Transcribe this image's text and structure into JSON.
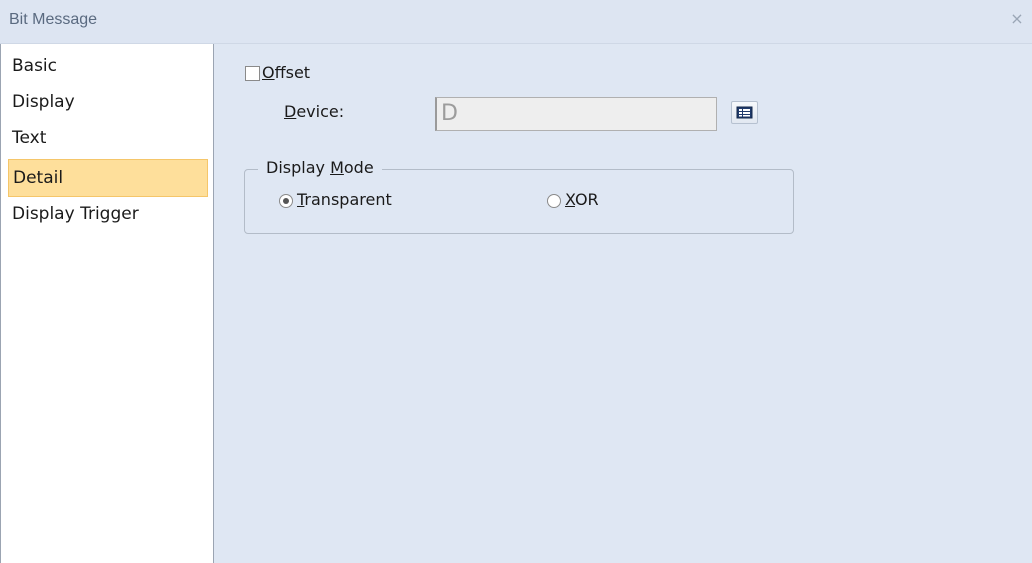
{
  "window": {
    "title": "Bit Message",
    "close_glyph": "×"
  },
  "sidebar": {
    "items": [
      {
        "label": "Basic",
        "selected": false
      },
      {
        "label": "Display",
        "selected": false
      },
      {
        "label": "Text",
        "selected": false
      },
      {
        "label": "Detail",
        "selected": true
      },
      {
        "label": "Display Trigger",
        "selected": false
      }
    ]
  },
  "detail": {
    "offset": {
      "hotkey": "O",
      "rest": "ffset",
      "checked": false
    },
    "device": {
      "hotkey": "D",
      "rest": "evice:",
      "value": "D"
    },
    "display_mode": {
      "legend_pre": "Display ",
      "legend_hotkey": "M",
      "legend_rest": "ode",
      "options": [
        {
          "hotkey": "T",
          "rest": "ransparent",
          "selected": true
        },
        {
          "hotkey": "X",
          "rest": "OR",
          "selected": false
        }
      ]
    }
  },
  "icons": {
    "device_browse": "device-list-icon"
  },
  "colors": {
    "titlebar": "#dde5f2",
    "content_bg": "#dfe7f3",
    "selected_bg": "#fedf9b",
    "selected_border": "#f5c66a"
  }
}
